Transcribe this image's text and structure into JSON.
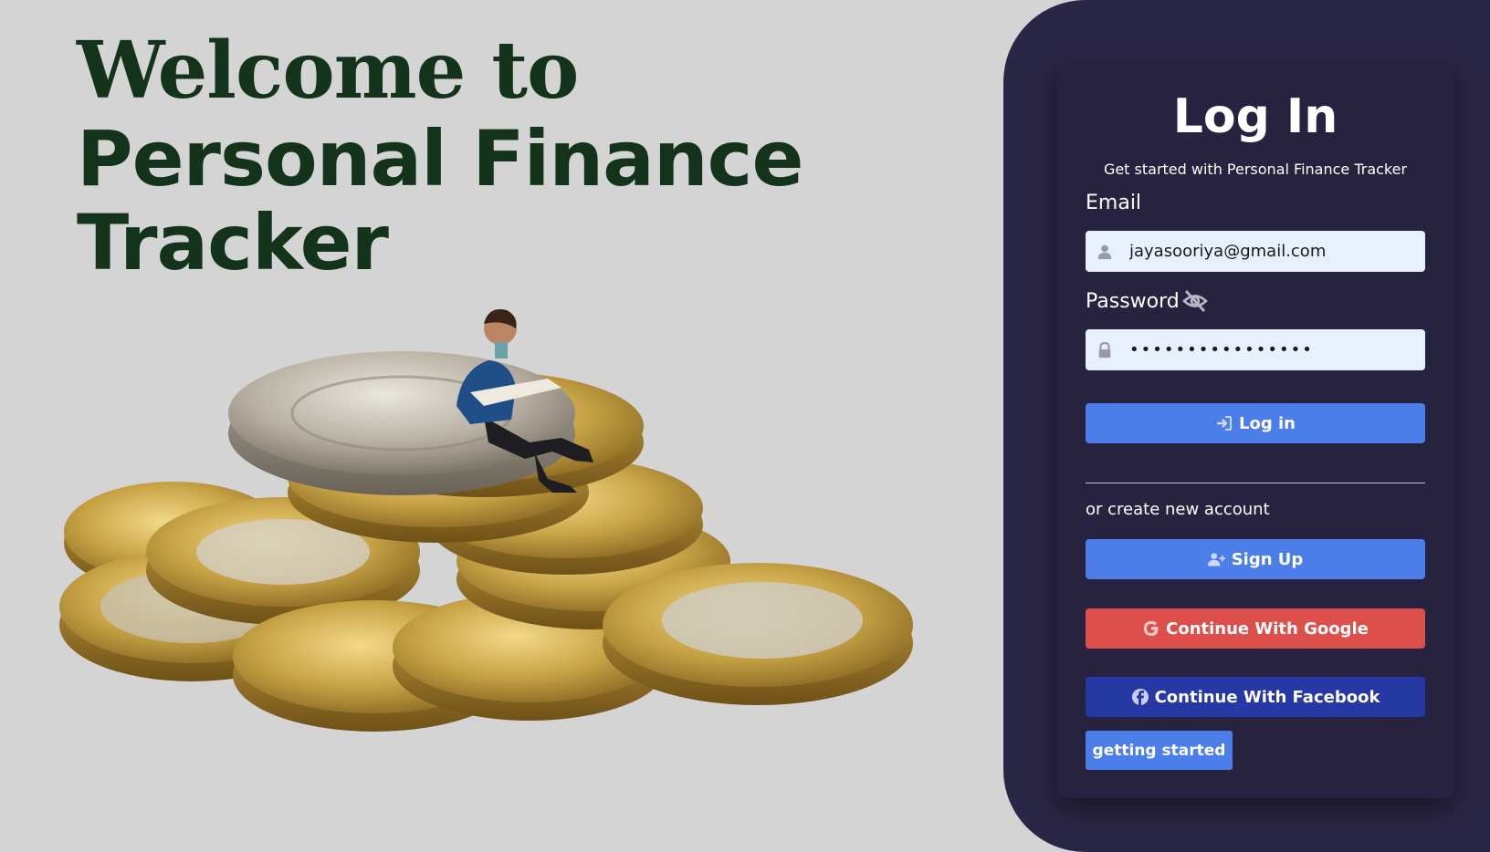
{
  "hero": {
    "line1": "Welcome to",
    "line2": "Personal Finance",
    "line3": "Tracker"
  },
  "login_card": {
    "title": "Log In",
    "subtitle": "Get started with Personal Finance Tracker",
    "email_label": "Email",
    "email_value": "jayasooriya@gmail.com",
    "password_label": "Password",
    "password_value": "••••••••••••••••",
    "login_button": "Log in",
    "or_text": "or create new account",
    "signup_button": "Sign Up",
    "google_button": "Continue With Google",
    "facebook_button": "Continue With Facebook",
    "getting_started_button": "getting started"
  },
  "icons": {
    "email_field": "user-icon",
    "password_field": "lock-icon",
    "password_toggle": "eye-slash-icon",
    "login": "sign-in-icon",
    "signup": "user-plus-icon",
    "google": "google-icon",
    "facebook": "facebook-icon"
  },
  "colors": {
    "background": "#d4d4d4",
    "hero_text": "#13331a",
    "panel": "#2a2645",
    "card": "#26223f",
    "primary_button": "#4b7ee8",
    "google_button": "#dc4f4a",
    "facebook_button": "#2638a3",
    "input_bg": "#e8effd"
  }
}
